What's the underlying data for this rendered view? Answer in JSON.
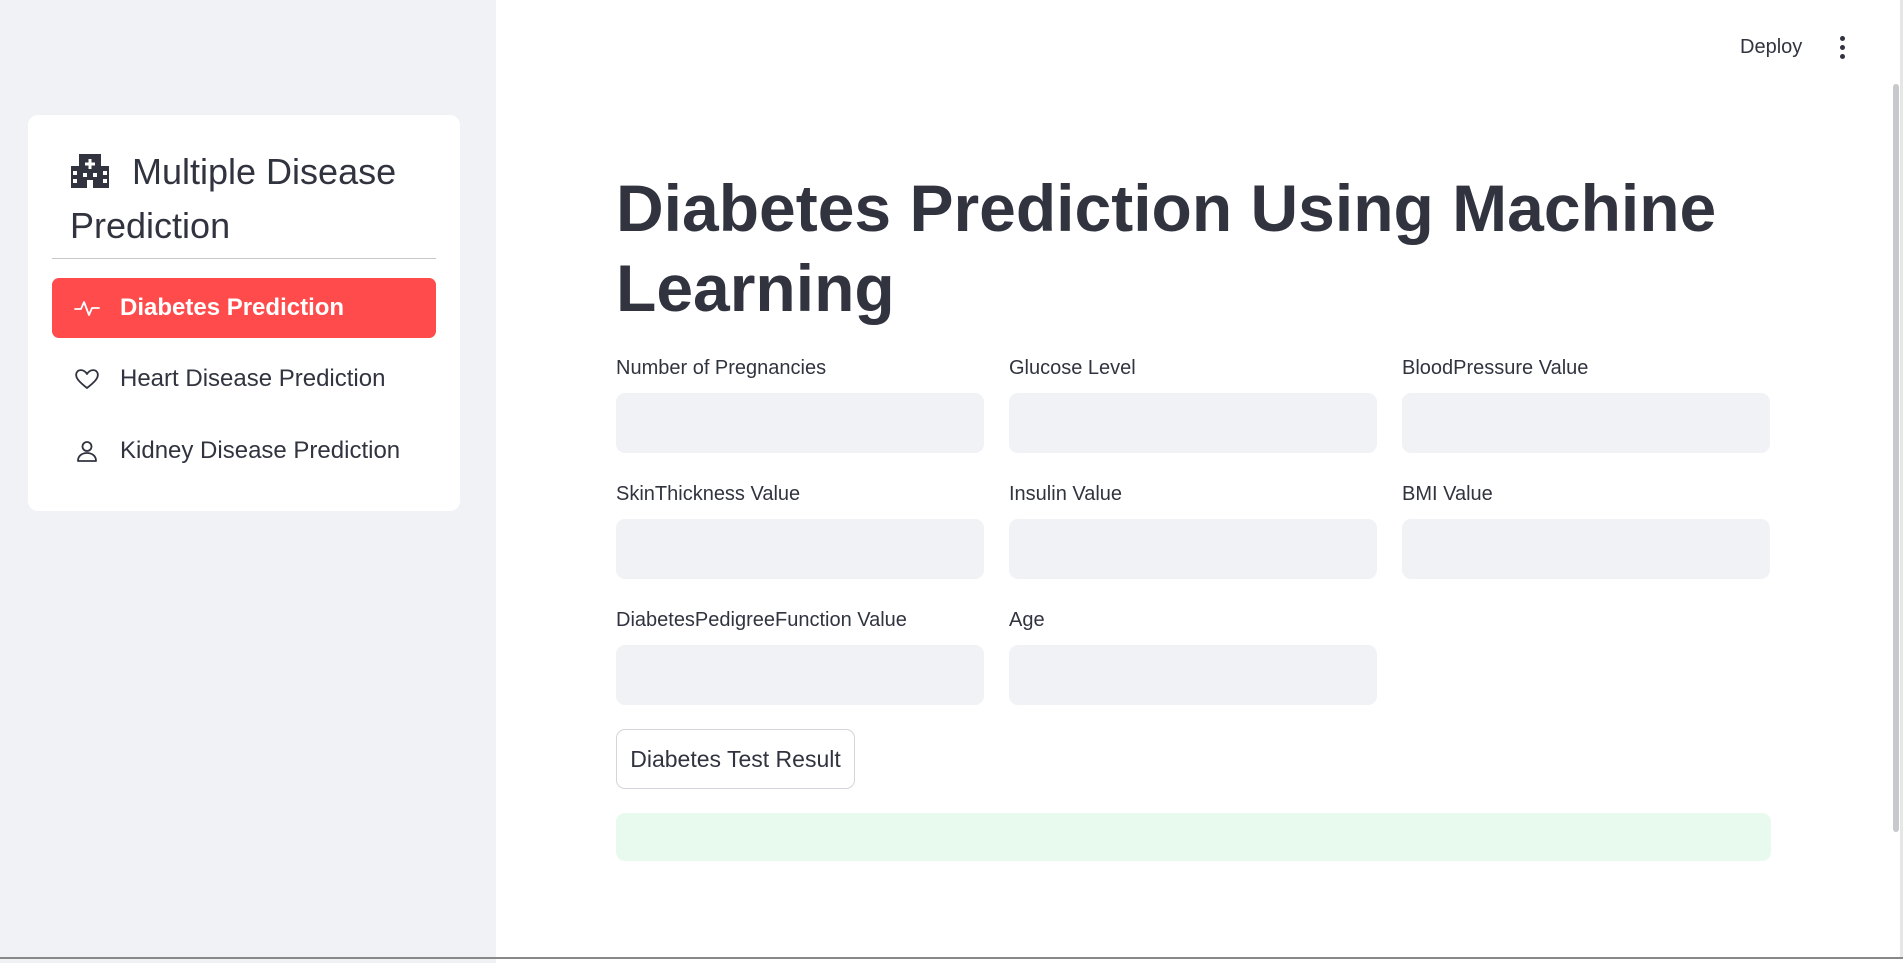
{
  "sidebar": {
    "title": "Multiple Disease Prediction",
    "title_icon": "hospital-icon",
    "items": [
      {
        "label": "Diabetes Prediction",
        "icon": "activity-icon",
        "active": true
      },
      {
        "label": "Heart Disease Prediction",
        "icon": "heart-icon",
        "active": false
      },
      {
        "label": "Kidney Disease Prediction",
        "icon": "person-icon",
        "active": false
      }
    ]
  },
  "header": {
    "deploy_label": "Deploy",
    "menu_icon": "kebab-menu-icon"
  },
  "main": {
    "title": "Diabetes Prediction Using Machine Learning",
    "fields": [
      {
        "label": "Number of Pregnancies",
        "value": ""
      },
      {
        "label": "Glucose Level",
        "value": ""
      },
      {
        "label": "BloodPressure Value",
        "value": ""
      },
      {
        "label": "SkinThickness Value",
        "value": ""
      },
      {
        "label": "Insulin Value",
        "value": ""
      },
      {
        "label": "BMI Value",
        "value": ""
      },
      {
        "label": "DiabetesPedigreeFunction Value",
        "value": ""
      },
      {
        "label": "Age",
        "value": ""
      }
    ],
    "result_button_label": "Diabetes Test Result",
    "result_message": ""
  },
  "colors": {
    "accent": "#ff4b4b",
    "sidebar_bg": "#f0f2f6",
    "success_bg": "#e8f9ee",
    "text": "#31333f"
  }
}
